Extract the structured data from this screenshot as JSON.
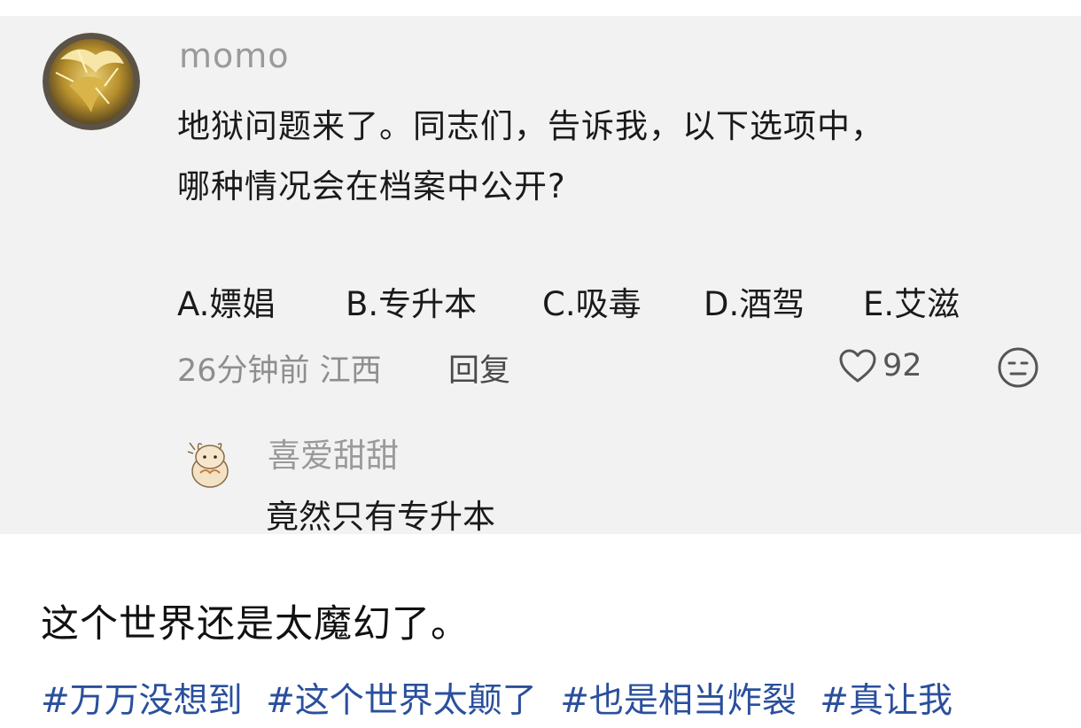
{
  "comment": {
    "username": "momo",
    "text_line1": "地狱问题来了。同志们，告诉我，以下选项中，",
    "text_line2": "哪种情况会在档案中公开?",
    "options": [
      "A.嫖娼",
      "B.专升本",
      "C.吸毒",
      "D.酒驾",
      "E.艾滋"
    ],
    "meta": "26分钟前 江西",
    "reply_label": "回复",
    "like_count": "92",
    "avatar_icon": "golden-lion-avatar",
    "like_icon": "heart-outline-icon",
    "emoji_icon": "neutral-face-icon"
  },
  "reply": {
    "username": "喜爱甜甜",
    "text": "竟然只有专升本",
    "avatar_icon": "hamster-avatar"
  },
  "post": {
    "caption": "这个世界还是太魔幻了。",
    "hashtags": [
      "#万万没想到",
      "#这个世界太颠了",
      "#也是相当炸裂",
      "#真让我"
    ],
    "hashtag_color": "#2a4f9c"
  }
}
